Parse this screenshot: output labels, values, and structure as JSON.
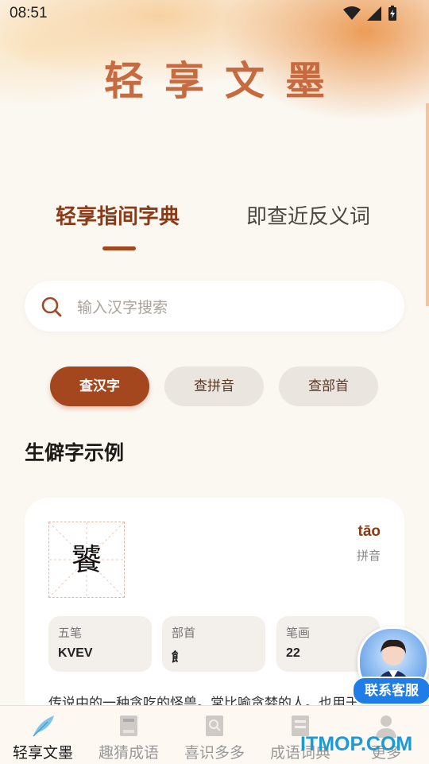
{
  "status_bar": {
    "time": "08:51"
  },
  "app_title": "轻享文墨",
  "tabs": [
    {
      "label": "轻享指间字典",
      "active": true
    },
    {
      "label": "即查近反义词",
      "active": false
    }
  ],
  "search": {
    "placeholder": "输入汉字搜索"
  },
  "search_modes": [
    {
      "label": "查汉字",
      "active": true
    },
    {
      "label": "查拼音",
      "active": false
    },
    {
      "label": "查部首",
      "active": false
    }
  ],
  "section_title": "生僻字示例",
  "example": {
    "character": "饕",
    "pinyin": "tāo",
    "pinyin_label": "拼音",
    "info": [
      {
        "label": "五笔",
        "value": "KVEV"
      },
      {
        "label": "部首",
        "value": "飠"
      },
      {
        "label": "笔画",
        "value": "22"
      }
    ],
    "description": "传说中的一种贪吃的怪兽。常比喻贪婪的人。也用于"
  },
  "customer_service": {
    "label": "联系客服"
  },
  "bottom_nav": [
    {
      "label": "轻享文墨",
      "icon": "feather-icon",
      "active": true
    },
    {
      "label": "趣猜成语",
      "icon": "book-icon",
      "active": false
    },
    {
      "label": "喜识多多",
      "icon": "search-doc-icon",
      "active": false
    },
    {
      "label": "成语词典",
      "icon": "dictionary-icon",
      "active": false
    },
    {
      "label": "更多",
      "icon": "person-icon",
      "active": false
    }
  ],
  "watermark": "ITMOP.COM",
  "colors": {
    "accent": "#a4461e",
    "title": "#c76a3f",
    "background": "#fbf7f1"
  }
}
